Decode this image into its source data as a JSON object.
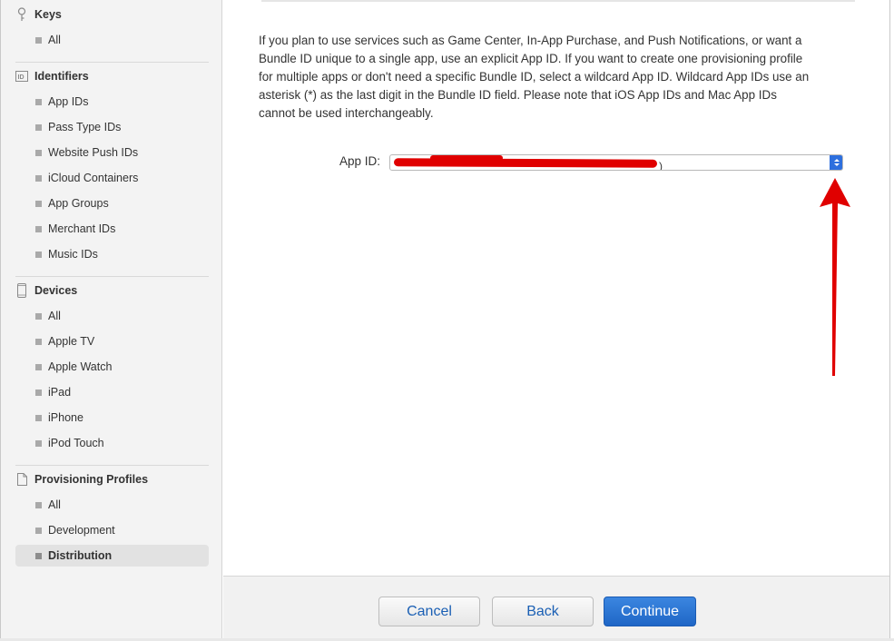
{
  "sidebar": {
    "keys": {
      "title": "Keys",
      "icon": "key-icon",
      "items": [
        "All"
      ]
    },
    "identifiers": {
      "title": "Identifiers",
      "icon": "id-icon",
      "items": [
        "App IDs",
        "Pass Type IDs",
        "Website Push IDs",
        "iCloud Containers",
        "App Groups",
        "Merchant IDs",
        "Music IDs"
      ]
    },
    "devices": {
      "title": "Devices",
      "icon": "device-icon",
      "items": [
        "All",
        "Apple TV",
        "Apple Watch",
        "iPad",
        "iPhone",
        "iPod Touch"
      ]
    },
    "profiles": {
      "title": "Provisioning Profiles",
      "icon": "document-icon",
      "items": [
        "All",
        "Development",
        "Distribution"
      ],
      "active": "Distribution"
    }
  },
  "main": {
    "description": "If you plan to use services such as Game Center, In-App Purchase, and Push Notifications, or want a Bundle ID unique to a single app, use an explicit App ID. If you want to create one provisioning profile for multiple apps or don't need a specific Bundle ID, select a wildcard App ID. Wildcard App IDs use an asterisk (*) as the last digit in the Bundle ID field. Please note that iOS App IDs and Mac App IDs cannot be used interchangeably.",
    "app_id_label": "App ID:",
    "app_id_value": ")"
  },
  "footer": {
    "cancel_label": "Cancel",
    "back_label": "Back",
    "continue_label": "Continue"
  },
  "colors": {
    "accent": "#2d6fde",
    "annotation_red": "#e00000"
  }
}
